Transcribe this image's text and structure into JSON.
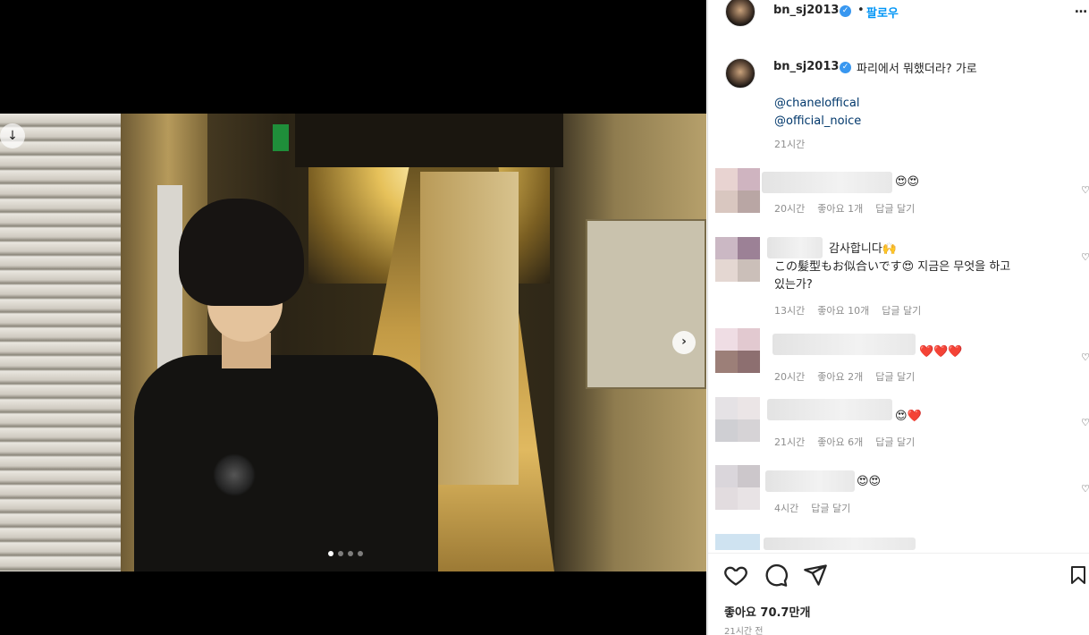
{
  "post": {
    "username": "bn_sj2013",
    "follow_label": "팔로우",
    "separator": "•",
    "more": "…",
    "caption": "파리에서 뭐했더라? 가로",
    "mentions": [
      "@chaneloffical",
      "@official_noice"
    ],
    "caption_time": "21시간",
    "likes": "좋아요 70.7만개",
    "post_time": "21시간 전",
    "verified_glyph": "✓",
    "carousel": {
      "total": 4,
      "active": 1
    }
  },
  "comments": [
    {
      "text": "😍😍",
      "time": "20시간",
      "likes": "좋아요 1개",
      "reply": "답글 달기",
      "avatar": [
        "#e8d3d1",
        "#cfb4c0",
        "#d9c7c0",
        "#b9a6a4"
      ]
    },
    {
      "text_lines": [
        "감사합니다🙌",
        "この髪型もお似合いです😍 지금은 무엇을 하고",
        "있는가?"
      ],
      "time": "13시간",
      "likes": "좋아요 10개",
      "reply": "답글 달기",
      "avatar": [
        "#cbb8c4",
        "#9c8196",
        "#e4d7d2",
        "#cbbfb9"
      ]
    },
    {
      "text": "❤️❤️❤️",
      "time": "20시간",
      "likes": "좋아요 2개",
      "reply": "답글 달기",
      "avatar": [
        "#efdde4",
        "#e2c9d0",
        "#9c7f78",
        "#8d6f70"
      ]
    },
    {
      "text": "😍❤️",
      "time": "21시간",
      "likes": "좋아요 6개",
      "reply": "답글 달기",
      "avatar": [
        "#e5e2e5",
        "#ebe5e6",
        "#cfcfd3",
        "#d6d3d6"
      ]
    },
    {
      "text": "😍😍",
      "time": "4시간",
      "likes": "",
      "reply": "답글 달기",
      "avatar": [
        "#dad6db",
        "#ccc7cb",
        "#e2dcdf",
        "#e8e3e5"
      ]
    }
  ],
  "icons": {
    "like": "heart-outline-icon",
    "comment": "comment-bubble-icon",
    "share": "paper-plane-icon",
    "save": "bookmark-icon",
    "next": "chevron-right-icon"
  },
  "colors": {
    "link": "#00376b",
    "follow": "#0095f6",
    "meta": "#8e8e8e"
  }
}
